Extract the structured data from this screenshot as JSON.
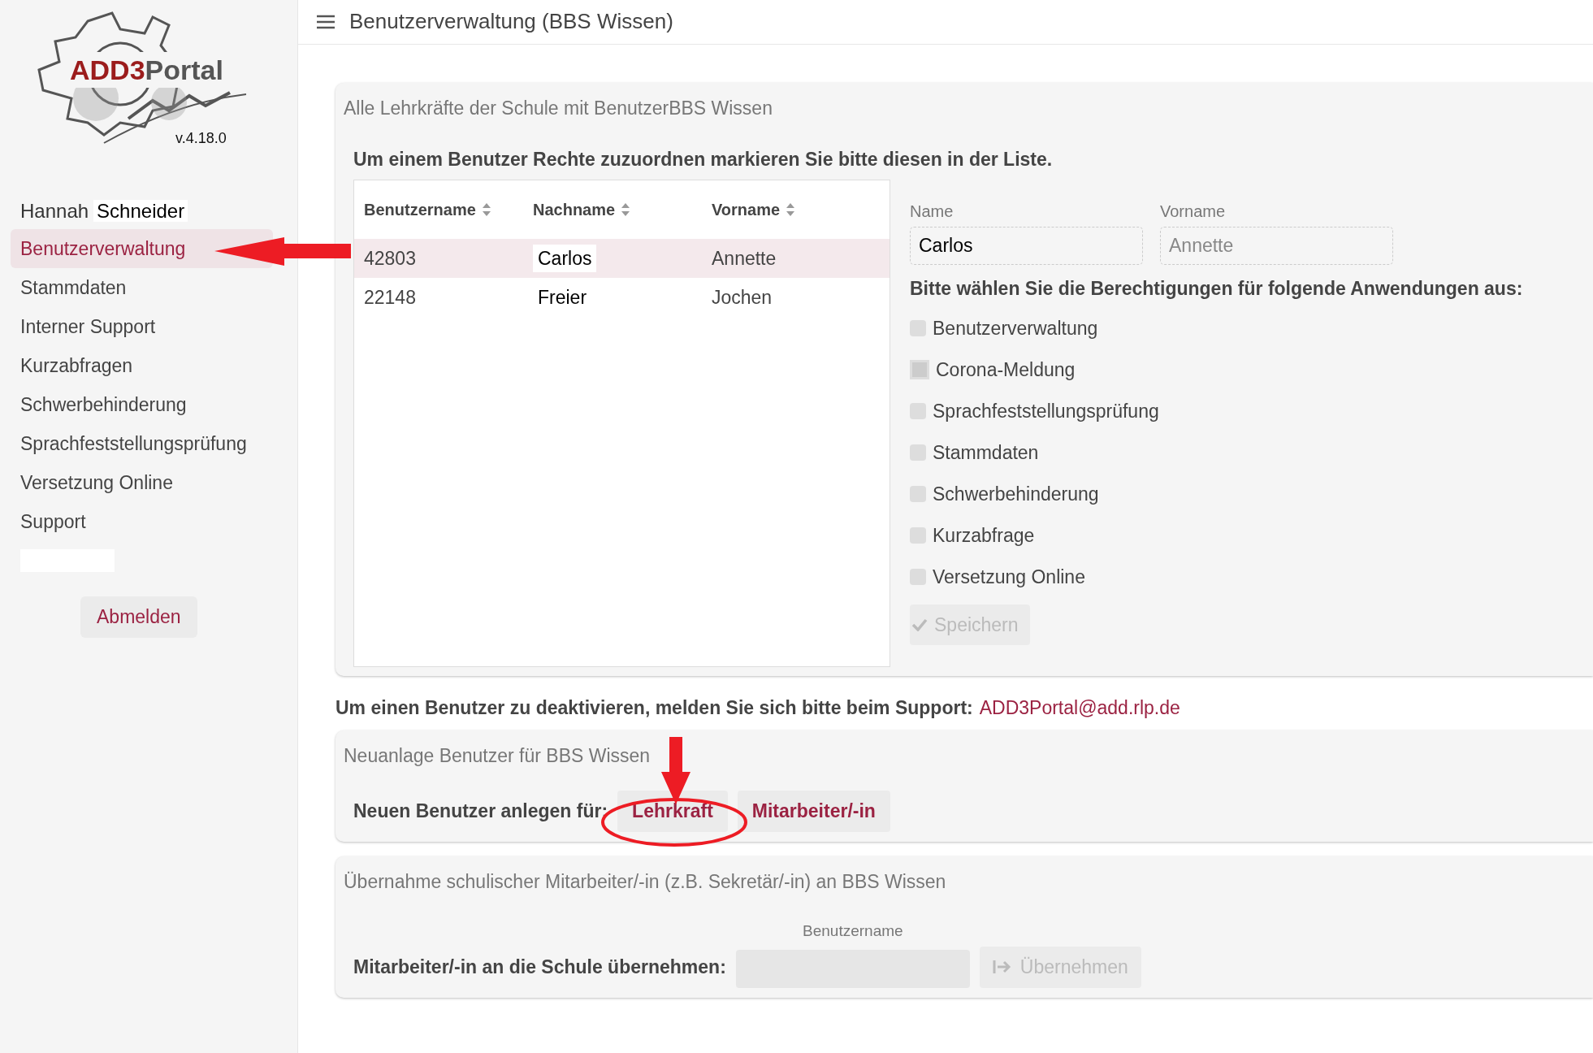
{
  "sidebar": {
    "logo": {
      "brand_primary": "ADD3",
      "brand_secondary": "Portal",
      "version": "v.4.18.0"
    },
    "user": {
      "first_name": "Hannah",
      "last_name": "Schneider"
    },
    "items": [
      {
        "label": "Benutzerverwaltung",
        "selected": true
      },
      {
        "label": "Stammdaten",
        "selected": false
      },
      {
        "label": "Interner Support",
        "selected": false
      },
      {
        "label": "Kurzabfragen",
        "selected": false
      },
      {
        "label": "Schwerbehinderung",
        "selected": false
      },
      {
        "label": "Sprachfeststellungsprüfung",
        "selected": false
      },
      {
        "label": "Versetzung Online",
        "selected": false
      },
      {
        "label": "Support",
        "selected": false
      }
    ],
    "logout": "Abmelden"
  },
  "header": {
    "title": "Benutzerverwaltung (BBS Wissen)"
  },
  "users_panel": {
    "title": "Alle Lehrkräfte der Schule mit BenutzerBBS Wissen",
    "instruction": "Um einem Benutzer Rechte zuzuordnen markieren Sie bitte diesen in der Liste.",
    "table": {
      "columns": [
        "Benutzername",
        "Nachname",
        "Vorname"
      ],
      "rows": [
        {
          "cells": [
            "42803",
            "Carlos",
            "Annette"
          ],
          "selected": true
        },
        {
          "cells": [
            "22148",
            "Freier",
            "Jochen"
          ],
          "selected": false
        }
      ]
    },
    "form": {
      "fields": [
        {
          "label": "Name",
          "value": "Carlos",
          "disabled": false
        },
        {
          "label": "Vorname",
          "value": "Annette",
          "disabled": true
        }
      ],
      "permissions_heading": "Bitte wählen Sie die Berechtigungen für folgende Anwendungen aus:",
      "permissions": [
        {
          "label": "Benutzerverwaltung",
          "checked": false,
          "focused": false
        },
        {
          "label": "Corona-Meldung",
          "checked": false,
          "focused": true
        },
        {
          "label": "Sprachfeststellungsprüfung",
          "checked": false,
          "focused": false
        },
        {
          "label": "Stammdaten",
          "checked": false,
          "focused": false
        },
        {
          "label": "Schwerbehinderung",
          "checked": false,
          "focused": false
        },
        {
          "label": "Kurzabfrage",
          "checked": false,
          "focused": false
        },
        {
          "label": "Versetzung Online",
          "checked": false,
          "focused": false
        }
      ],
      "save_button": {
        "label": "Speichern",
        "disabled": true
      }
    }
  },
  "deactivate_note": {
    "text": "Um einen Benutzer zu deaktivieren, melden Sie sich bitte beim Support:",
    "email": "ADD3Portal@add.rlp.de"
  },
  "new_user_panel": {
    "title": "Neuanlage Benutzer für BBS Wissen",
    "label": "Neuen Benutzer anlegen für:",
    "buttons": [
      "Lehrkraft",
      "Mitarbeiter/-in"
    ]
  },
  "transfer_panel": {
    "title": "Übernahme schulischer Mitarbeiter/-in (z.B. Sekretär/-in) an BBS Wissen",
    "label": "Mitarbeiter/-in an die Schule übernehmen:",
    "field_label": "Benutzername",
    "button": {
      "label": "Übernehmen",
      "disabled": true
    }
  }
}
